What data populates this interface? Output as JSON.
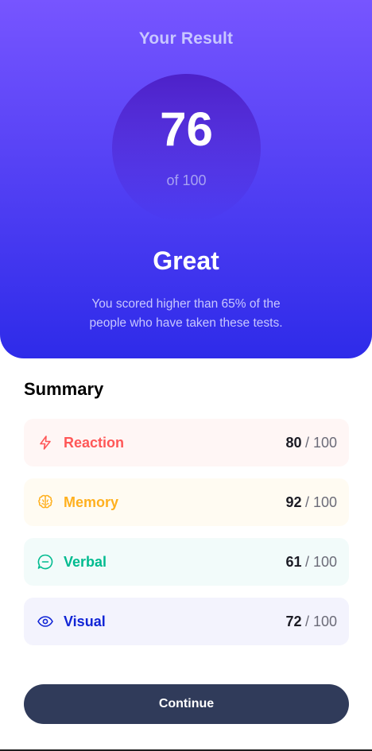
{
  "result": {
    "title": "Your Result",
    "score": "76",
    "max_label": "of 100",
    "rating": "Great",
    "description": "You scored higher than 65% of the people who have taken these tests."
  },
  "summary": {
    "title": "Summary",
    "items": [
      {
        "label": "Reaction",
        "score": "80",
        "separator": "/",
        "max": "100",
        "icon": "lightning-icon",
        "color": "#ff5757"
      },
      {
        "label": "Memory",
        "score": "92",
        "separator": "/",
        "max": "100",
        "icon": "brain-icon",
        "color": "#ffb01f"
      },
      {
        "label": "Verbal",
        "score": "61",
        "separator": "/",
        "max": "100",
        "icon": "chat-bubble-icon",
        "color": "#00bb8f"
      },
      {
        "label": "Visual",
        "score": "72",
        "separator": "/",
        "max": "100",
        "icon": "eye-icon",
        "color": "#1125d6"
      }
    ]
  },
  "continue_label": "Continue",
  "colors": {
    "gradient_top": "#7755ff",
    "gradient_bottom": "#2e2be9",
    "button": "#303b5a"
  }
}
